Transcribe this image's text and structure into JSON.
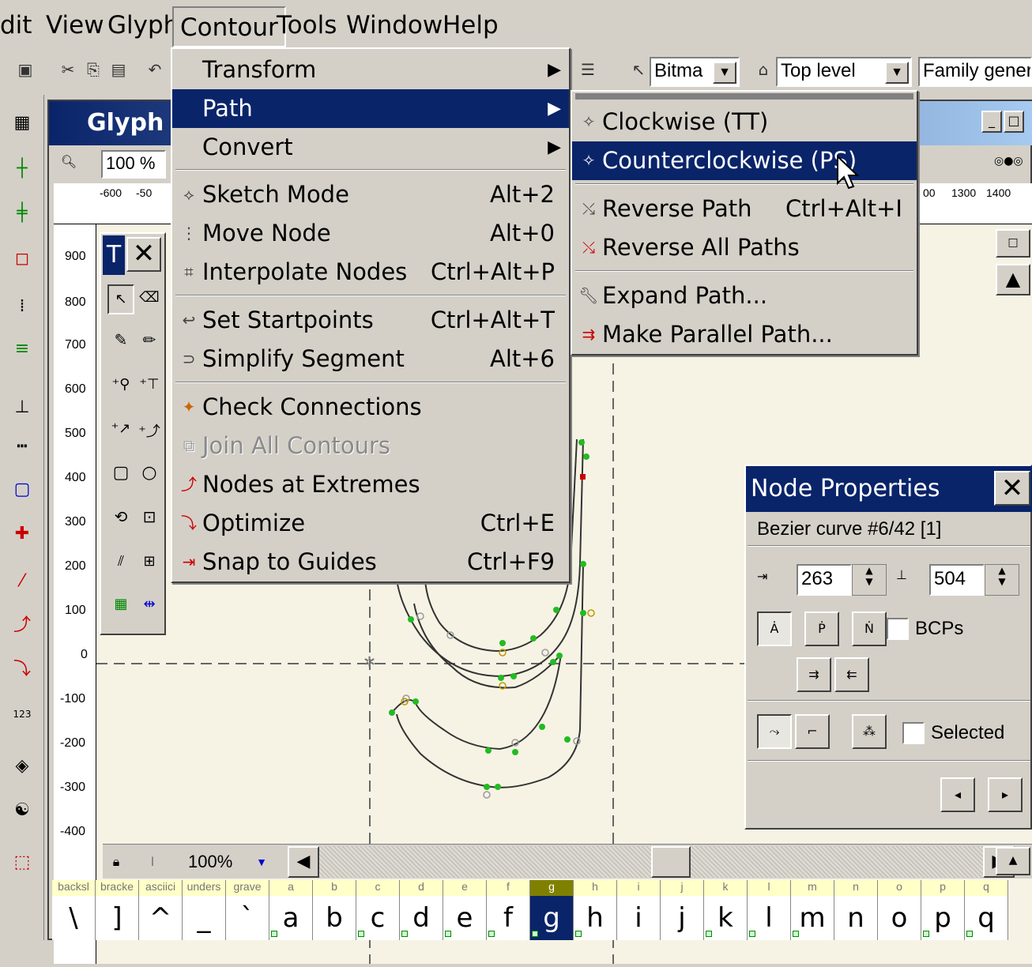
{
  "menubar": {
    "items": [
      {
        "label": "dit",
        "name": "menu-edit"
      },
      {
        "label": "View",
        "name": "menu-view"
      },
      {
        "label": "Glyph",
        "name": "menu-glyph"
      },
      {
        "label": "Contour",
        "name": "menu-contour"
      },
      {
        "label": "Tools",
        "name": "menu-tools"
      },
      {
        "label": "Window",
        "name": "menu-window"
      },
      {
        "label": "Help",
        "name": "menu-help"
      }
    ]
  },
  "toolbar": {
    "bitmap_combo": "Bitma",
    "level_combo": "Top level",
    "family_combo": "Family genera"
  },
  "glyph_window": {
    "title": "Glyph",
    "zoom": "100 %",
    "ruler_top": [
      "-600",
      "-50",
      "00",
      "1300",
      "1400"
    ],
    "ruler_left": [
      "900",
      "800",
      "700",
      "600",
      "500",
      "400",
      "300",
      "200",
      "100",
      "0",
      "-100",
      "-200",
      "-300",
      "-400"
    ],
    "bottom_zoom": "100%"
  },
  "toolbox_panel": {
    "title": "T"
  },
  "contour_menu": {
    "items": [
      {
        "label": "Transform",
        "shortcut": "",
        "submenu": true
      },
      {
        "label": "Path",
        "shortcut": "",
        "submenu": true,
        "highlighted": true
      },
      {
        "label": "Convert",
        "shortcut": "",
        "submenu": true
      },
      {
        "label": "Sketch Mode",
        "shortcut": "Alt+2",
        "icon": "sketch-icon"
      },
      {
        "label": "Move Node",
        "shortcut": "Alt+0",
        "icon": "move-node-icon"
      },
      {
        "label": "Interpolate Nodes",
        "shortcut": "Ctrl+Alt+P",
        "icon": "interpolate-icon"
      },
      {
        "label": "Set Startpoints",
        "shortcut": "Ctrl+Alt+T",
        "icon": "startpoint-icon"
      },
      {
        "label": "Simplify Segment",
        "shortcut": "Alt+6",
        "icon": "simplify-icon"
      },
      {
        "label": "Check Connections",
        "shortcut": "",
        "icon": "check-icon"
      },
      {
        "label": "Join All Contours",
        "shortcut": "",
        "icon": "join-icon",
        "disabled": true
      },
      {
        "label": "Nodes at Extremes",
        "shortcut": "",
        "icon": "extremes-icon"
      },
      {
        "label": "Optimize",
        "shortcut": "Ctrl+E",
        "icon": "optimize-icon"
      },
      {
        "label": "Snap to Guides",
        "shortcut": "Ctrl+F9",
        "icon": "snap-icon"
      }
    ]
  },
  "path_submenu": {
    "items": [
      {
        "label": "Clockwise (TT)",
        "shortcut": ""
      },
      {
        "label": "Counterclockwise (PS)",
        "shortcut": "",
        "highlighted": true
      },
      {
        "label": "Reverse Path",
        "shortcut": "Ctrl+Alt+I"
      },
      {
        "label": "Reverse All Paths",
        "shortcut": ""
      },
      {
        "label": "Expand Path...",
        "shortcut": ""
      },
      {
        "label": "Make Parallel Path...",
        "shortcut": ""
      }
    ]
  },
  "node_properties": {
    "title": "Node Properties",
    "description": "Bezier curve #6/42 [1]",
    "x_value": "263",
    "y_value": "504",
    "bcps_label": "BCPs",
    "selected_label": "Selected"
  },
  "glyph_strip": {
    "names": [
      "backsl",
      "bracke",
      "asciici",
      "unders",
      "grave",
      "a",
      "b",
      "c",
      "d",
      "e",
      "f",
      "g",
      "h",
      "i",
      "j",
      "k",
      "l",
      "m",
      "n",
      "o",
      "p",
      "q"
    ],
    "chars": [
      "\\",
      "]",
      "^",
      "_",
      "`",
      "a",
      "b",
      "c",
      "d",
      "e",
      "f",
      "g",
      "h",
      "i",
      "j",
      "k",
      "l",
      "m",
      "n",
      "o",
      "p",
      "q"
    ],
    "selected_index": 11
  },
  "colors": {
    "menu_highlight": "#0a246a",
    "canvas": "#f6f3e5",
    "node_green": "#22bb22"
  }
}
